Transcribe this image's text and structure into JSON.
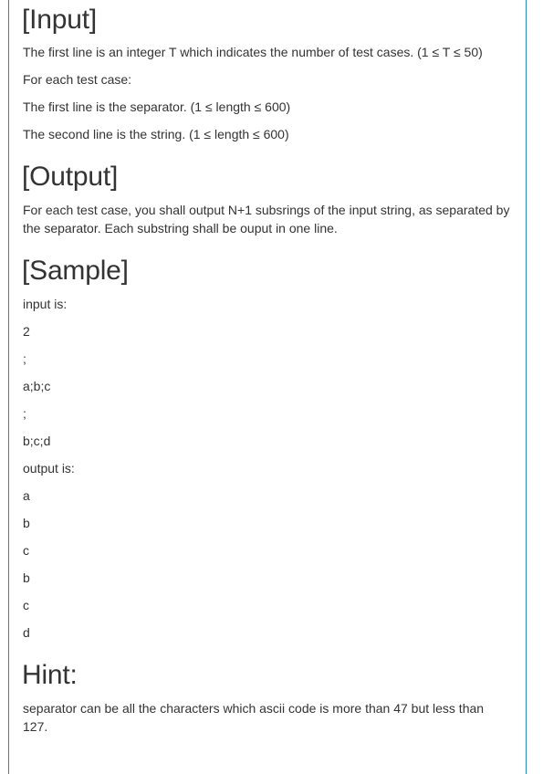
{
  "input": {
    "heading": "[Input]",
    "lines": [
      "The first line is an integer T which indicates the number of test cases. (1 ≤ T ≤ 50)",
      "For each test case:",
      "The first line is the separator. (1 ≤ length ≤ 600)",
      "The second line is the string. (1 ≤ length ≤ 600)"
    ]
  },
  "output": {
    "heading": "[Output]",
    "text": "For each test case, you shall output N+1 subsrings of the input string, as separated by the separator. Each substring shall be ouput in one line."
  },
  "sample": {
    "heading": "[Sample]",
    "input_label": "input is:",
    "input_lines": [
      "2",
      ";",
      "a;b;c",
      ";",
      "b;c;d"
    ],
    "output_label": "output is:",
    "output_lines": [
      "a",
      "b",
      "c",
      "b",
      "c",
      "d"
    ]
  },
  "hint": {
    "heading": "Hint:",
    "text": "separator can be all the characters which ascii code is more than 47 but less than 127."
  }
}
